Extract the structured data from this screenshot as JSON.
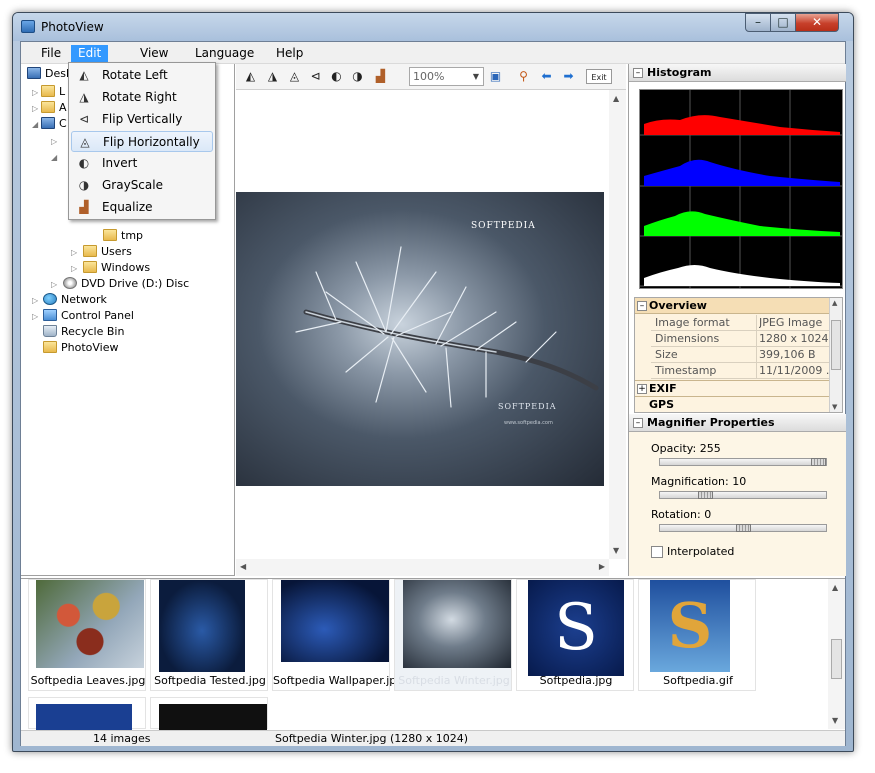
{
  "window": {
    "title": "PhotoView"
  },
  "menubar": [
    "File",
    "Edit",
    "View",
    "Language",
    "Help"
  ],
  "edit_menu": {
    "items": [
      {
        "label": "Rotate Left",
        "icon": "rotate-left-icon"
      },
      {
        "label": "Rotate Right",
        "icon": "rotate-right-icon"
      },
      {
        "label": "Flip Vertically",
        "icon": "flip-vertical-icon"
      },
      {
        "label": "Flip Horizontally",
        "icon": "flip-horizontal-icon"
      },
      {
        "label": "Invert",
        "icon": "invert-icon"
      },
      {
        "label": "GrayScale",
        "icon": "grayscale-icon"
      },
      {
        "label": "Equalize",
        "icon": "equalize-icon"
      }
    ],
    "highlighted": "Flip Horizontally"
  },
  "tree": {
    "visible_fragment": {
      "root": "Desk",
      "a": "L",
      "b": "A",
      "c": "C"
    },
    "items": [
      "tmp",
      "Users",
      "Windows",
      "DVD Drive (D:) Disc",
      "Network",
      "Control Panel",
      "Recycle Bin",
      "PhotoView"
    ]
  },
  "toolbar": {
    "zoom": "100%",
    "exit_label": "Exit"
  },
  "histogram": {
    "title": "Histogram",
    "channels": [
      "#ff0000",
      "#0000ff",
      "#00ff00",
      "#ffffff"
    ]
  },
  "overview": {
    "title": "Overview",
    "rows": [
      {
        "key": "Image format",
        "value": "JPEG Image"
      },
      {
        "key": "Dimensions",
        "value": "1280 x 1024"
      },
      {
        "key": "Size",
        "value": "399,106 B"
      },
      {
        "key": "Timestamp",
        "value": "11/11/2009 ..."
      }
    ],
    "sections": [
      "EXIF",
      "GPS"
    ]
  },
  "magnifier": {
    "title": "Magnifier Properties",
    "opacity": {
      "label": "Opacity: 255",
      "value": 255,
      "max": 255
    },
    "magnification": {
      "label": "Magnification: 10",
      "value": 10,
      "max": 40
    },
    "rotation": {
      "label": "Rotation: 0",
      "value": 0,
      "min": -180,
      "max": 180
    },
    "interpolated": {
      "label": "Interpolated",
      "checked": false
    }
  },
  "thumbnails": [
    {
      "caption": "Softpedia Leaves.jpg"
    },
    {
      "caption": "Softpedia Tested.jpg"
    },
    {
      "caption": "Softpedia Wallpaper.jpg"
    },
    {
      "caption": "Softpedia Winter.jpg",
      "selected": true
    },
    {
      "caption": "Softpedia.jpg"
    },
    {
      "caption": "Softpedia.gif"
    }
  ],
  "photo_watermark": "SOFTPEDIA",
  "photo_watermark_url": "www.softpedia.com",
  "status": {
    "count": "14 images",
    "file": "Softpedia Winter.jpg (1280 x 1024)"
  },
  "colors": {
    "menu_highlight": "#3399ff",
    "overview_bg": "#fdf3e0",
    "magnifier_bg": "#fdf6e6"
  }
}
